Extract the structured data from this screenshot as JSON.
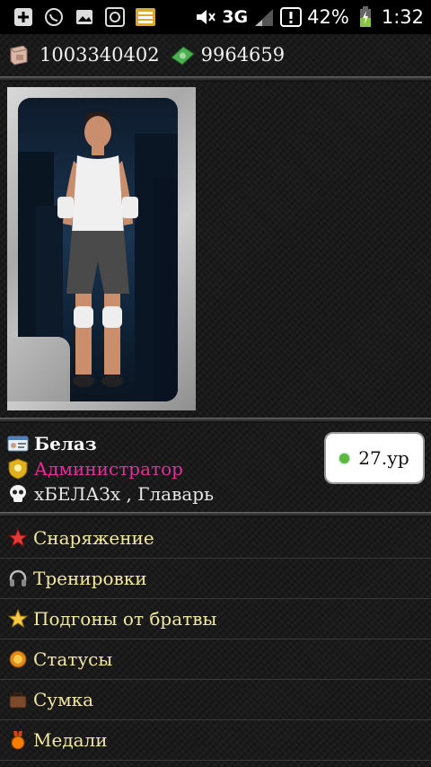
{
  "status_bar": {
    "network": "3G",
    "battery_percent": "42%",
    "time": "1:32",
    "icons": [
      "add-box-icon",
      "whatsapp-icon",
      "gallery-icon",
      "gear-box-icon",
      "storage-icon",
      "mute-icon",
      "signal-icon",
      "alert-box-icon",
      "battery-charging-icon"
    ]
  },
  "currency": {
    "gold": "1003340402",
    "cash": "9964659"
  },
  "profile": {
    "name": "Белаз",
    "role": "Администратор",
    "role_color": "#e0309a",
    "gang": "хБЕЛАЗх , Главарь",
    "level": "27.ур"
  },
  "menu": [
    {
      "label": "Снаряжение",
      "icon": "star-red-icon"
    },
    {
      "label": "Тренировки",
      "icon": "headphones-icon"
    },
    {
      "label": "Подгоны от братвы",
      "icon": "star-gold-icon"
    },
    {
      "label": "Статусы",
      "icon": "badge-icon"
    },
    {
      "label": "Сумка",
      "icon": "bag-icon"
    },
    {
      "label": "Медали",
      "icon": "medal-icon"
    }
  ]
}
